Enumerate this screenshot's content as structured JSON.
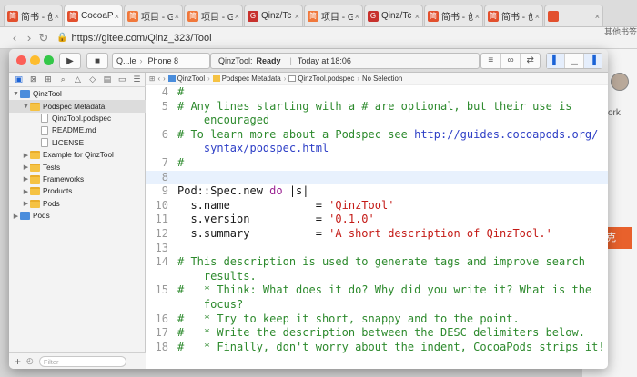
{
  "browser": {
    "tabs": [
      {
        "label": "简书 - 创",
        "fav": "简",
        "color": "red"
      },
      {
        "label": "CocoaPo",
        "fav": "简",
        "color": "red"
      },
      {
        "label": "项目 - G",
        "fav": "简",
        "color": "orange"
      },
      {
        "label": "项目 - G",
        "fav": "简",
        "color": "orange"
      },
      {
        "label": "Qinz/Tc",
        "fav": "G",
        "color": "gh"
      },
      {
        "label": "项目 - G",
        "fav": "简",
        "color": "orange"
      },
      {
        "label": "Qinz/Tc",
        "fav": "G",
        "color": "gh"
      },
      {
        "label": "简书 - 创",
        "fav": "简",
        "color": "red"
      },
      {
        "label": "简书 - 创",
        "fav": "简",
        "color": "red"
      },
      {
        "label": "",
        "fav": "",
        "color": "red"
      }
    ],
    "url": "https://gitee.com/Qinz_323/Tool",
    "right_page": {
      "work_label": "ork",
      "button_label": "克",
      "stars": "其他书签"
    }
  },
  "xcode": {
    "scheme_target": "Q...le",
    "scheme_device": "iPhone 8",
    "status_project": "QinzTool:",
    "status_state": "Ready",
    "status_time": "Today at 18:06",
    "navigator": {
      "filter_placeholder": "Filter",
      "items": [
        {
          "label": "QinzTool",
          "indent": 0,
          "icon": "proj",
          "disclosure": "▼",
          "selected": false
        },
        {
          "label": "Podspec Metadata",
          "indent": 1,
          "icon": "folder",
          "disclosure": "▼",
          "selected": true
        },
        {
          "label": "QinzTool.podspec",
          "indent": 2,
          "icon": "file",
          "disclosure": "",
          "selected": false
        },
        {
          "label": "README.md",
          "indent": 2,
          "icon": "file",
          "disclosure": "",
          "selected": false
        },
        {
          "label": "LICENSE",
          "indent": 2,
          "icon": "file",
          "disclosure": "",
          "selected": false
        },
        {
          "label": "Example for QinzTool",
          "indent": 1,
          "icon": "folder",
          "disclosure": "▶",
          "selected": false
        },
        {
          "label": "Tests",
          "indent": 1,
          "icon": "folder",
          "disclosure": "▶",
          "selected": false
        },
        {
          "label": "Frameworks",
          "indent": 1,
          "icon": "folder",
          "disclosure": "▶",
          "selected": false
        },
        {
          "label": "Products",
          "indent": 1,
          "icon": "folder",
          "disclosure": "▶",
          "selected": false
        },
        {
          "label": "Pods",
          "indent": 1,
          "icon": "folder",
          "disclosure": "▶",
          "selected": false
        },
        {
          "label": "Pods",
          "indent": 0,
          "icon": "proj",
          "disclosure": "▶",
          "selected": false
        }
      ]
    },
    "jumpbar": [
      "QinzTool",
      "Podspec Metadata",
      "QinzTool.podspec",
      "No Selection"
    ],
    "code": [
      {
        "n": "4",
        "parts": [
          {
            "t": "#",
            "c": "cm"
          }
        ]
      },
      {
        "n": "5",
        "parts": [
          {
            "t": "# Any lines starting with a # are optional, but their use is",
            "c": "cm"
          }
        ]
      },
      {
        "n": "",
        "parts": [
          {
            "t": "    encouraged",
            "c": "cm"
          }
        ]
      },
      {
        "n": "6",
        "parts": [
          {
            "t": "# To learn more about a Podspec see ",
            "c": "cm"
          },
          {
            "t": "http://guides.cocoapods.org/",
            "c": "url2"
          }
        ]
      },
      {
        "n": "",
        "parts": [
          {
            "t": "    syntax/podspec.html",
            "c": "url2"
          }
        ]
      },
      {
        "n": "7",
        "parts": [
          {
            "t": "#",
            "c": "cm"
          }
        ]
      },
      {
        "n": "8",
        "parts": [
          {
            "t": "",
            "c": ""
          }
        ],
        "cur": true
      },
      {
        "n": "9",
        "parts": [
          {
            "t": "Pod::Spec.new ",
            "c": ""
          },
          {
            "t": "do",
            "c": "kw"
          },
          {
            "t": " |s|",
            "c": ""
          }
        ]
      },
      {
        "n": "10",
        "parts": [
          {
            "t": "  s.name             = ",
            "c": ""
          },
          {
            "t": "'QinzTool'",
            "c": "str"
          }
        ]
      },
      {
        "n": "11",
        "parts": [
          {
            "t": "  s.version          = ",
            "c": ""
          },
          {
            "t": "'0.1.0'",
            "c": "str"
          }
        ]
      },
      {
        "n": "12",
        "parts": [
          {
            "t": "  s.summary          = ",
            "c": ""
          },
          {
            "t": "'A short description of QinzTool.'",
            "c": "str"
          }
        ]
      },
      {
        "n": "13",
        "parts": [
          {
            "t": "",
            "c": ""
          }
        ]
      },
      {
        "n": "14",
        "parts": [
          {
            "t": "# This description is used to generate tags and improve search",
            "c": "cm"
          }
        ]
      },
      {
        "n": "",
        "parts": [
          {
            "t": "    results.",
            "c": "cm"
          }
        ]
      },
      {
        "n": "15",
        "parts": [
          {
            "t": "#   * Think: What does it do? Why did you write it? What is the",
            "c": "cm"
          }
        ]
      },
      {
        "n": "",
        "parts": [
          {
            "t": "    focus?",
            "c": "cm"
          }
        ]
      },
      {
        "n": "16",
        "parts": [
          {
            "t": "#   * Try to keep it short, snappy and to the point.",
            "c": "cm"
          }
        ]
      },
      {
        "n": "17",
        "parts": [
          {
            "t": "#   * Write the description between the DESC delimiters below.",
            "c": "cm"
          }
        ]
      },
      {
        "n": "18",
        "parts": [
          {
            "t": "#   * Finally, don't worry about the indent, CocoaPods strips it!",
            "c": "cm"
          }
        ]
      }
    ]
  }
}
